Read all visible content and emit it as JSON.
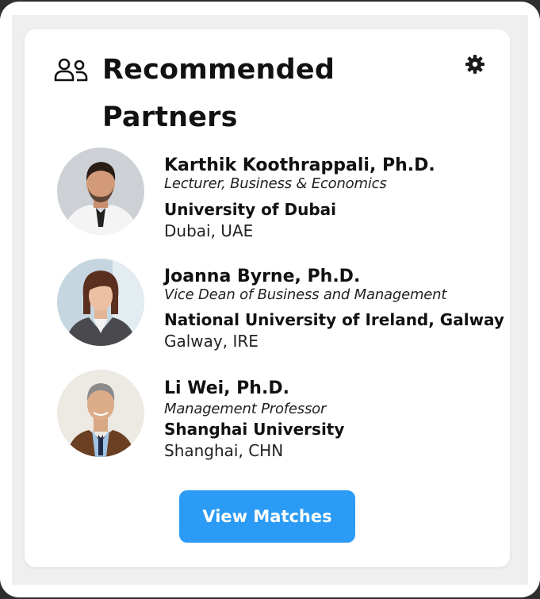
{
  "header": {
    "title": "Recommended Partners",
    "people_icon": "people-icon",
    "settings_icon": "gear-icon"
  },
  "partners": [
    {
      "name": "Karthik Koothrappali, Ph.D.",
      "role": "Lecturer, Business & Economics",
      "university": "University of Dubai",
      "location": "Dubai, UAE"
    },
    {
      "name": "Joanna Byrne, Ph.D.",
      "role": "Vice Dean of Business and Management",
      "university": "National University of Ireland, Galway",
      "location": "Galway, IRE"
    },
    {
      "name": "Li Wei, Ph.D.",
      "role": "Management Professor",
      "university": "Shanghai University",
      "location": "Shanghai, CHN"
    }
  ],
  "actions": {
    "view_matches_label": "View Matches"
  },
  "colors": {
    "accent": "#2b9bf6",
    "background": "#efefef",
    "card": "#ffffff"
  }
}
